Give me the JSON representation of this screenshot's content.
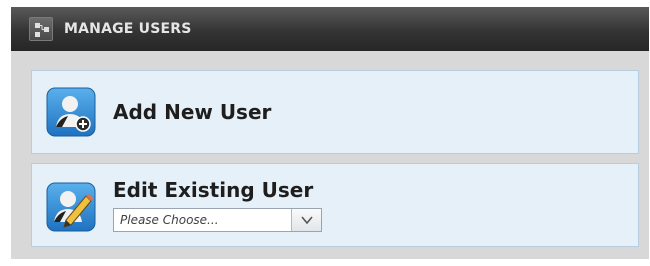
{
  "header": {
    "title": "MANAGE USERS",
    "icon": "sitemap-icon"
  },
  "add_user": {
    "title": "Add New User",
    "icon": "add-user-icon"
  },
  "edit_user": {
    "title": "Edit Existing User",
    "icon": "edit-user-icon",
    "select": {
      "selected": "Please Choose...",
      "arrow_icon": "chevron-down-icon"
    }
  },
  "colors": {
    "header_bg": "#343434",
    "panel_bg": "#d8d8d8",
    "card_bg": "#e6f0f8",
    "card_border": "#b9cde0",
    "icon_blue": "#2f8fd8"
  }
}
